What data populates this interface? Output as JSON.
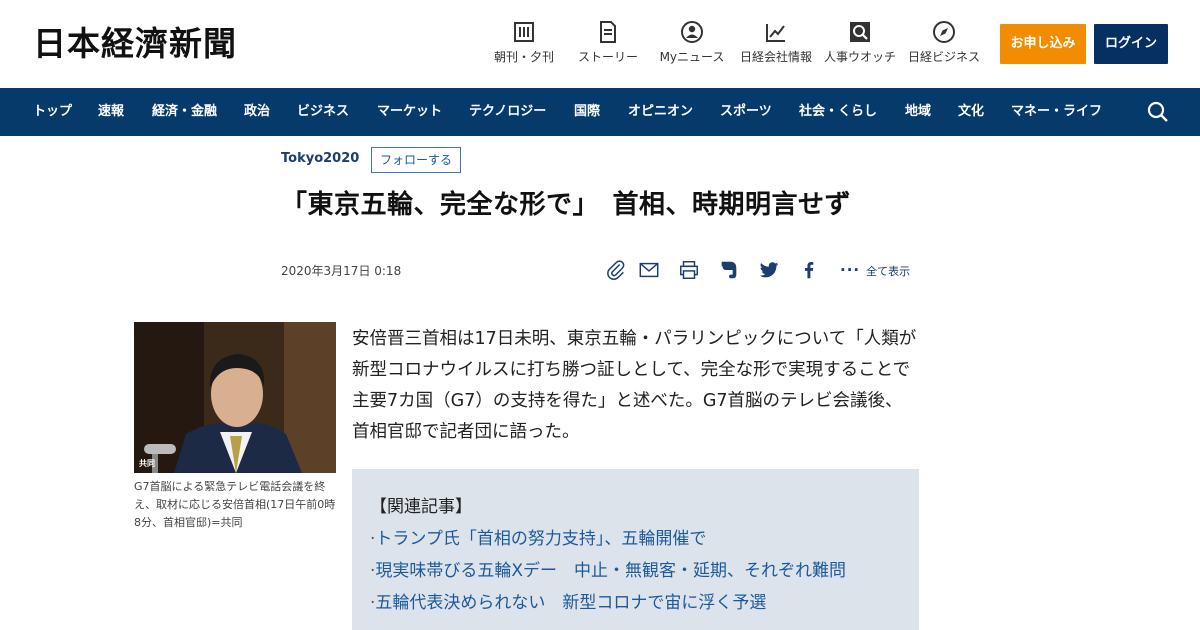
{
  "header": {
    "logo": "日本経濟新聞",
    "nav": [
      {
        "label": "朝刊・夕刊",
        "icon": "newspaper-icon"
      },
      {
        "label": "ストーリー",
        "icon": "document-icon"
      },
      {
        "label": "Myニュース",
        "icon": "person-icon"
      },
      {
        "label": "日経会社情報",
        "icon": "chart-icon"
      },
      {
        "label": "人事ウオッチ",
        "icon": "magnifier-icon"
      },
      {
        "label": "日経ビジネス",
        "icon": "compass-icon"
      }
    ],
    "apply_label": "お申し込み",
    "login_label": "ログイン"
  },
  "navbar": {
    "items": [
      "トップ",
      "速報",
      "経済・金融",
      "政治",
      "ビジネス",
      "マーケット",
      "テクノロジー",
      "国際",
      "オピニオン",
      "スポーツ",
      "社会・くらし",
      "地域",
      "文化",
      "マネー・ライフ"
    ]
  },
  "article": {
    "topic": "Tokyo2020",
    "follow_label": "フォローする",
    "title": "「東京五輪、完全な形で」　首相、時期明言せず",
    "date": "2020年3月17日 0:18",
    "show_all_label": "全て表示",
    "photo_credit": "共同",
    "caption": "G7首脳による緊急テレビ電話会議を終え、取材に応じる安倍首相(17日午前0時8分、首相官邸)=共同",
    "lead": "安倍晋三首相は17日未明、東京五輪・パラリンピックについて「人類が新型コロナウイルスに打ち勝つ証しとして、完全な形で実現することで主要7カ国（G7）の支持を得た」と述べた。G7首脳のテレビ会議後、首相官邸で記者団に語った。",
    "related_heading": "【関連記事】",
    "related": [
      "トランプ氏「首相の努力支持」、五輪開催で",
      "現実味帯びる五輪Xデー　中止・無観客・延期、それぞれ難問",
      "五輪代表決められない　新型コロナで宙に浮く予選"
    ]
  },
  "colors": {
    "navbar": "#063a6b",
    "apply": "#f28c00",
    "login": "#053061",
    "link": "#1a5a9c",
    "related_bg": "#dde3ea"
  }
}
